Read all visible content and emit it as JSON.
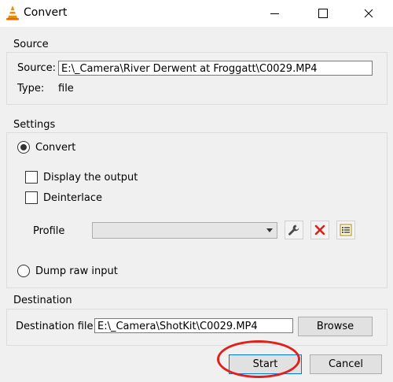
{
  "window": {
    "title": "Convert",
    "icons": {
      "app": "vlc-cone-icon",
      "minimize": "minimize-icon",
      "maximize": "maximize-icon",
      "close": "close-icon"
    }
  },
  "source": {
    "group_title": "Source",
    "source_label": "Source:",
    "source_value": "E:\\_Camera\\River Derwent at Froggatt\\C0029.MP4",
    "type_label": "Type:",
    "type_value": "file"
  },
  "settings": {
    "group_title": "Settings",
    "convert_label": "Convert",
    "convert_selected": true,
    "display_output_label": "Display the output",
    "display_output_checked": false,
    "deinterlace_label": "Deinterlace",
    "deinterlace_checked": false,
    "profile_label": "Profile",
    "profile_value": "",
    "profile_icons": {
      "edit": "wrench-icon",
      "delete": "red-x-delete-icon",
      "new": "new-profile-list-icon"
    },
    "dump_raw_label": "Dump raw input",
    "dump_raw_selected": false
  },
  "destination": {
    "group_title": "Destination",
    "file_label": "Destination file:",
    "file_value": "E:\\_Camera\\ShotKit\\C0029.MP4",
    "browse_label": "Browse"
  },
  "actions": {
    "start_label": "Start",
    "cancel_label": "Cancel"
  },
  "annotation": {
    "color": "#e0201b",
    "target": "start-button"
  }
}
